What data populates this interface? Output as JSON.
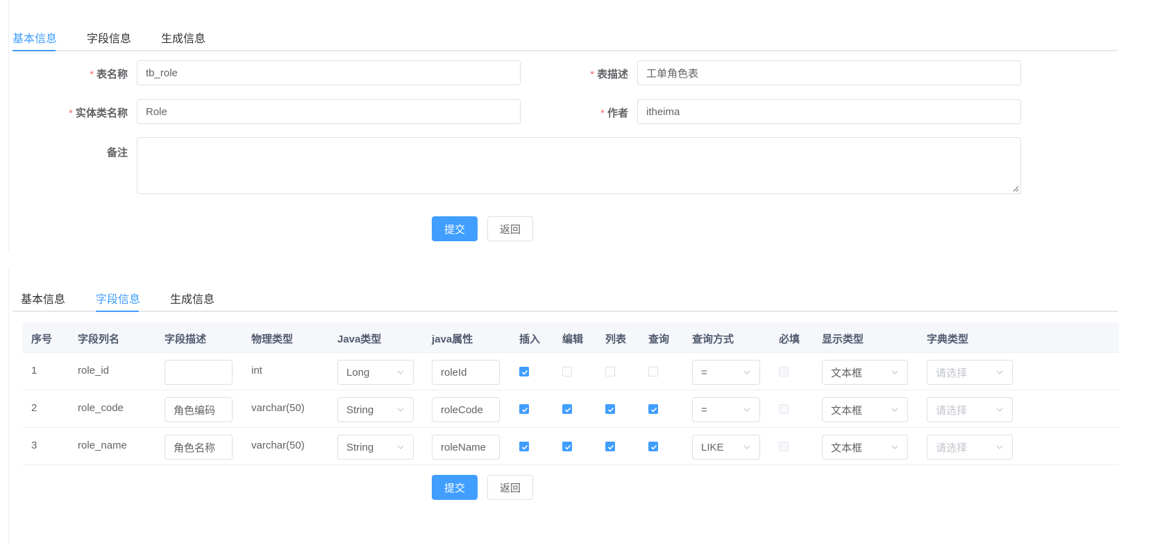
{
  "tabs": [
    "基本信息",
    "字段信息",
    "生成信息"
  ],
  "basic_form": {
    "table_name": {
      "label": "表名称",
      "value": "tb_role"
    },
    "table_desc": {
      "label": "表描述",
      "value": "工单角色表"
    },
    "class_name": {
      "label": "实体类名称",
      "value": "Role"
    },
    "author": {
      "label": "作者",
      "value": "itheima"
    },
    "remark": {
      "label": "备注",
      "value": ""
    },
    "required_mark": "*"
  },
  "buttons": {
    "submit": "提交",
    "back": "返回"
  },
  "columns_table": {
    "headers": [
      "序号",
      "字段列名",
      "字段描述",
      "物理类型",
      "Java类型",
      "java属性",
      "插入",
      "编辑",
      "列表",
      "查询",
      "查询方式",
      "必填",
      "显示类型",
      "字典类型"
    ],
    "rows": [
      {
        "index": "1",
        "column": "role_id",
        "desc": "",
        "phys_type": "int",
        "java_type": "Long",
        "java_field": "roleId",
        "insert": true,
        "edit": false,
        "list": false,
        "query": false,
        "query_type": "=",
        "required": false,
        "html_type": "文本框",
        "dict_type": "请选择"
      },
      {
        "index": "2",
        "column": "role_code",
        "desc": "角色编码",
        "phys_type": "varchar(50)",
        "java_type": "String",
        "java_field": "roleCode",
        "insert": true,
        "edit": true,
        "list": true,
        "query": true,
        "query_type": "=",
        "required": false,
        "html_type": "文本框",
        "dict_type": "请选择"
      },
      {
        "index": "3",
        "column": "role_name",
        "desc": "角色名称",
        "phys_type": "varchar(50)",
        "java_type": "String",
        "java_field": "roleName",
        "insert": true,
        "edit": true,
        "list": true,
        "query": true,
        "query_type": "LIKE",
        "required": false,
        "html_type": "文本框",
        "dict_type": "请选择"
      }
    ]
  },
  "colors": {
    "accent": "#409eff",
    "required": "#f56c6c",
    "border": "#dcdfe6"
  }
}
